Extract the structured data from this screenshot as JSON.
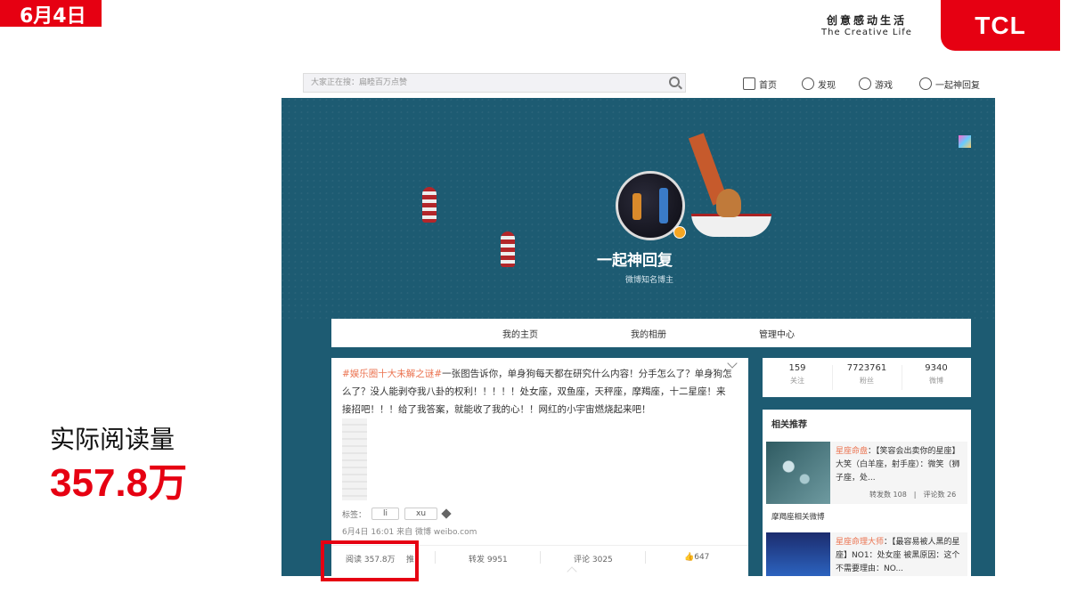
{
  "slide": {
    "date_tab": "6月4日",
    "slogan_cn": "创意感动生活",
    "slogan_en": "The Creative Life",
    "logo": "TCL",
    "metric_label": "实际阅读量",
    "metric_value": "357.8万"
  },
  "topbar": {
    "search_placeholder": "大家正在搜：扁睦百万点赞",
    "nav": [
      "首页",
      "发现",
      "游戏",
      "一起神回复"
    ]
  },
  "profile": {
    "name": "一起神回复",
    "subtitle": "微博知名博主"
  },
  "tabs": [
    "我的主页",
    "我的相册",
    "管理中心"
  ],
  "post": {
    "topic": "#娱乐圈十大未解之谜#",
    "text": "一张图告诉你，单身狗每天都在研究什么内容！分手怎么了？单身狗怎么了？没人能剥夺我八卦的权利！！！！！处女座，双鱼座，天秤座，摩羯座，十二星座！来接招吧！！！给了我答案，就能收了我的心！！网红的小宇宙燃烧起来吧！",
    "tags_label": "标签：",
    "tags": [
      "li",
      "xu"
    ],
    "meta": "6月4日 16:01 来自 微博 weibo.com",
    "actions": {
      "read": "阅读 357.8万",
      "promote": "推",
      "repost": "转发 9951",
      "comment": "评论 3025",
      "like": "647"
    }
  },
  "stats": [
    {
      "num": "159",
      "label": "关注"
    },
    {
      "num": "7723761",
      "label": "粉丝"
    },
    {
      "num": "9340",
      "label": "微博"
    }
  ],
  "recommendations": {
    "title": "相关推荐",
    "items": [
      {
        "user": "星座命盘",
        "text": "：【笑容会出卖你的星座】大笑（白羊座，射手座）：微笑（狮子座，处...",
        "repost": "转发数 108",
        "comment": "评论数 26"
      },
      {
        "user": "星座命理大师",
        "text": "：【最容易被人黑的星座】NO1：处女座 被黑原因：这个不需要理由：NO..."
      }
    ],
    "caption": "摩羯座相关微博"
  }
}
